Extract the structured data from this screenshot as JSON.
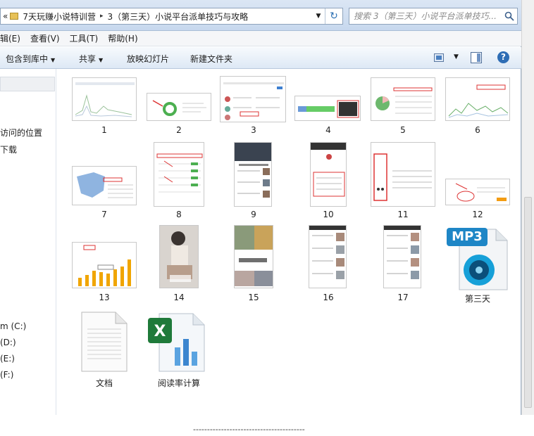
{
  "address": {
    "segments": [
      "7天玩赚小说特训营",
      "3（第三天）小说平台派单技巧与攻略"
    ],
    "overflow_glyph": "«",
    "separator_glyph": "▸"
  },
  "search": {
    "placeholder": "搜索 3（第三天）小说平台派单技巧..."
  },
  "menu": [
    "辑(E)",
    "查看(V)",
    "工具(T)",
    "帮助(H)"
  ],
  "toolbar": {
    "include_label": "包含到库中",
    "share_label": "共享",
    "slideshow_label": "放映幻灯片",
    "new_folder_label": "新建文件夹",
    "help_label": "?"
  },
  "nav": {
    "items": [
      "访问的位置",
      "下载",
      "m (C:)",
      "(D:)",
      "(E:)",
      "(F:)"
    ]
  },
  "files": [
    {
      "label": "1",
      "kind": "image"
    },
    {
      "label": "2",
      "kind": "image"
    },
    {
      "label": "3",
      "kind": "image"
    },
    {
      "label": "4",
      "kind": "image"
    },
    {
      "label": "5",
      "kind": "image"
    },
    {
      "label": "6",
      "kind": "image"
    },
    {
      "label": "7",
      "kind": "image"
    },
    {
      "label": "8",
      "kind": "image"
    },
    {
      "label": "9",
      "kind": "image"
    },
    {
      "label": "10",
      "kind": "image"
    },
    {
      "label": "11",
      "kind": "image"
    },
    {
      "label": "12",
      "kind": "image"
    },
    {
      "label": "13",
      "kind": "image"
    },
    {
      "label": "14",
      "kind": "image"
    },
    {
      "label": "15",
      "kind": "image"
    },
    {
      "label": "16",
      "kind": "image"
    },
    {
      "label": "17",
      "kind": "image"
    },
    {
      "label": "第三天",
      "kind": "mp3",
      "icon_text": "MP3"
    },
    {
      "label": "文档",
      "kind": "text"
    },
    {
      "label": "阅读率计算",
      "kind": "excel"
    }
  ],
  "footer": {
    "dashes": "----------------------------------------"
  }
}
